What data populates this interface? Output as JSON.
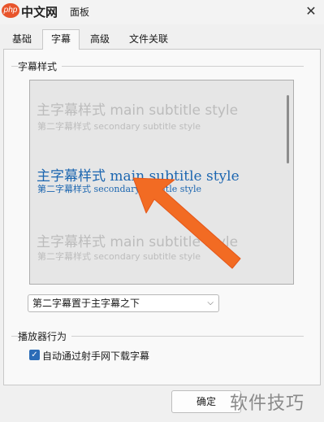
{
  "window": {
    "title_partial": "面板",
    "close_glyph": "✕"
  },
  "watermark": {
    "badge": "php",
    "site": "中文网",
    "corner": "软件技巧"
  },
  "tabs": [
    {
      "label": "基础",
      "active": false
    },
    {
      "label": "字幕",
      "active": true
    },
    {
      "label": "高级",
      "active": false
    },
    {
      "label": "文件关联",
      "active": false
    }
  ],
  "subtitle_style": {
    "group_label": "字幕样式",
    "samples": [
      {
        "main": "主字幕样式 main subtitle style",
        "secondary": "第二字幕样式 secondary subtitle style",
        "state": "faded"
      },
      {
        "main": "主字幕样式 main subtitle style",
        "secondary": "第二字幕样式 secondary subtitle style",
        "state": "selected"
      },
      {
        "main": "主字幕样式 main subtitle style",
        "secondary": "第二字幕样式 secondary subtitle style",
        "state": "faded"
      }
    ]
  },
  "position_select": {
    "value": "第二字幕置于主字幕之下",
    "chevron": "⌵"
  },
  "player_behavior": {
    "group_label": "播放器行为",
    "auto_download": {
      "label": "自动通过射手网下载字幕",
      "checked": true
    }
  },
  "buttons": {
    "ok": "确定"
  },
  "colors": {
    "accent": "#2b6cb7",
    "selected_sample": "#1c66b0",
    "arrow": "#f26b23"
  }
}
